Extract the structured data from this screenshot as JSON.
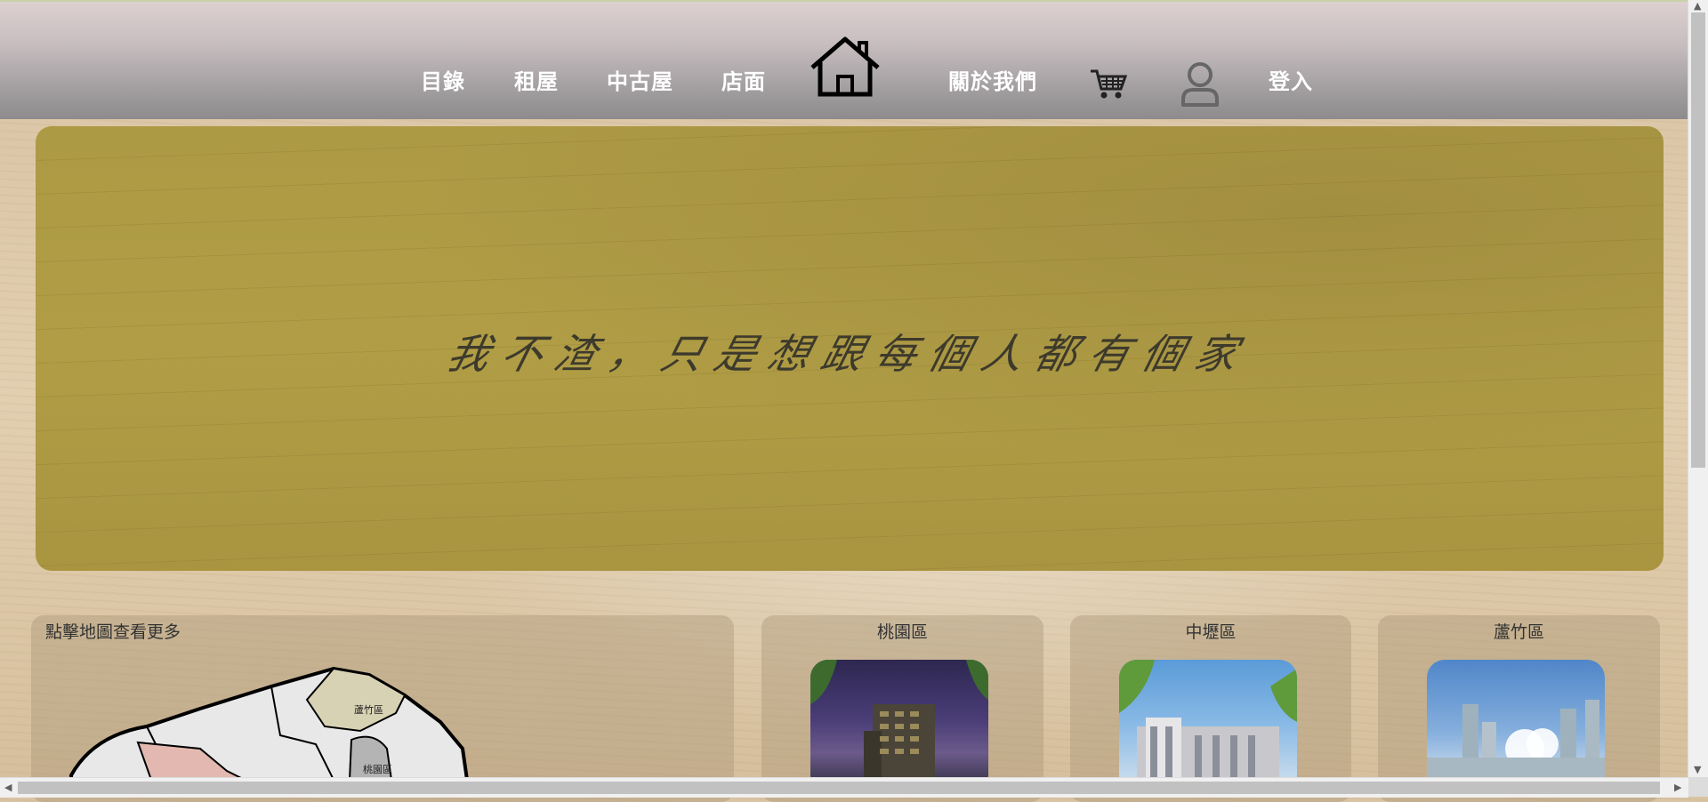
{
  "nav": {
    "items": [
      "目錄",
      "租屋",
      "中古屋",
      "店面"
    ],
    "about": "關於我們",
    "login": "登入",
    "icons": [
      "home-logo",
      "cart-icon",
      "user-icon"
    ]
  },
  "hero": {
    "slogan": "我不渣，只是想跟每個人都有個家"
  },
  "map_card": {
    "caption": "點擊地圖查看更多",
    "labels": [
      "蘆竹區",
      "桃園區"
    ]
  },
  "districts": [
    {
      "name": "桃園區"
    },
    {
      "name": "中壢區"
    },
    {
      "name": "蘆竹區"
    }
  ],
  "colors": {
    "hero_bg": "#ad9a44",
    "nav_text": "#ffffff"
  }
}
